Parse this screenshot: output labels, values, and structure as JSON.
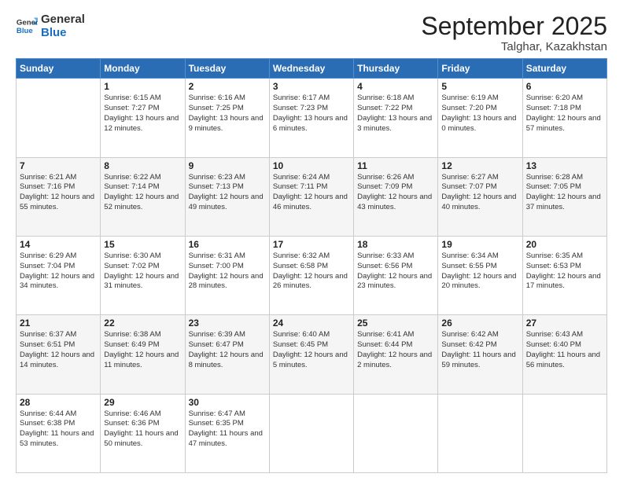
{
  "header": {
    "logo_general": "General",
    "logo_blue": "Blue",
    "month_title": "September 2025",
    "subtitle": "Talghar, Kazakhstan"
  },
  "days_of_week": [
    "Sunday",
    "Monday",
    "Tuesday",
    "Wednesday",
    "Thursday",
    "Friday",
    "Saturday"
  ],
  "weeks": [
    [
      {
        "day": "",
        "sunrise": "",
        "sunset": "",
        "daylight": ""
      },
      {
        "day": "1",
        "sunrise": "Sunrise: 6:15 AM",
        "sunset": "Sunset: 7:27 PM",
        "daylight": "Daylight: 13 hours and 12 minutes."
      },
      {
        "day": "2",
        "sunrise": "Sunrise: 6:16 AM",
        "sunset": "Sunset: 7:25 PM",
        "daylight": "Daylight: 13 hours and 9 minutes."
      },
      {
        "day": "3",
        "sunrise": "Sunrise: 6:17 AM",
        "sunset": "Sunset: 7:23 PM",
        "daylight": "Daylight: 13 hours and 6 minutes."
      },
      {
        "day": "4",
        "sunrise": "Sunrise: 6:18 AM",
        "sunset": "Sunset: 7:22 PM",
        "daylight": "Daylight: 13 hours and 3 minutes."
      },
      {
        "day": "5",
        "sunrise": "Sunrise: 6:19 AM",
        "sunset": "Sunset: 7:20 PM",
        "daylight": "Daylight: 13 hours and 0 minutes."
      },
      {
        "day": "6",
        "sunrise": "Sunrise: 6:20 AM",
        "sunset": "Sunset: 7:18 PM",
        "daylight": "Daylight: 12 hours and 57 minutes."
      }
    ],
    [
      {
        "day": "7",
        "sunrise": "Sunrise: 6:21 AM",
        "sunset": "Sunset: 7:16 PM",
        "daylight": "Daylight: 12 hours and 55 minutes."
      },
      {
        "day": "8",
        "sunrise": "Sunrise: 6:22 AM",
        "sunset": "Sunset: 7:14 PM",
        "daylight": "Daylight: 12 hours and 52 minutes."
      },
      {
        "day": "9",
        "sunrise": "Sunrise: 6:23 AM",
        "sunset": "Sunset: 7:13 PM",
        "daylight": "Daylight: 12 hours and 49 minutes."
      },
      {
        "day": "10",
        "sunrise": "Sunrise: 6:24 AM",
        "sunset": "Sunset: 7:11 PM",
        "daylight": "Daylight: 12 hours and 46 minutes."
      },
      {
        "day": "11",
        "sunrise": "Sunrise: 6:26 AM",
        "sunset": "Sunset: 7:09 PM",
        "daylight": "Daylight: 12 hours and 43 minutes."
      },
      {
        "day": "12",
        "sunrise": "Sunrise: 6:27 AM",
        "sunset": "Sunset: 7:07 PM",
        "daylight": "Daylight: 12 hours and 40 minutes."
      },
      {
        "day": "13",
        "sunrise": "Sunrise: 6:28 AM",
        "sunset": "Sunset: 7:05 PM",
        "daylight": "Daylight: 12 hours and 37 minutes."
      }
    ],
    [
      {
        "day": "14",
        "sunrise": "Sunrise: 6:29 AM",
        "sunset": "Sunset: 7:04 PM",
        "daylight": "Daylight: 12 hours and 34 minutes."
      },
      {
        "day": "15",
        "sunrise": "Sunrise: 6:30 AM",
        "sunset": "Sunset: 7:02 PM",
        "daylight": "Daylight: 12 hours and 31 minutes."
      },
      {
        "day": "16",
        "sunrise": "Sunrise: 6:31 AM",
        "sunset": "Sunset: 7:00 PM",
        "daylight": "Daylight: 12 hours and 28 minutes."
      },
      {
        "day": "17",
        "sunrise": "Sunrise: 6:32 AM",
        "sunset": "Sunset: 6:58 PM",
        "daylight": "Daylight: 12 hours and 26 minutes."
      },
      {
        "day": "18",
        "sunrise": "Sunrise: 6:33 AM",
        "sunset": "Sunset: 6:56 PM",
        "daylight": "Daylight: 12 hours and 23 minutes."
      },
      {
        "day": "19",
        "sunrise": "Sunrise: 6:34 AM",
        "sunset": "Sunset: 6:55 PM",
        "daylight": "Daylight: 12 hours and 20 minutes."
      },
      {
        "day": "20",
        "sunrise": "Sunrise: 6:35 AM",
        "sunset": "Sunset: 6:53 PM",
        "daylight": "Daylight: 12 hours and 17 minutes."
      }
    ],
    [
      {
        "day": "21",
        "sunrise": "Sunrise: 6:37 AM",
        "sunset": "Sunset: 6:51 PM",
        "daylight": "Daylight: 12 hours and 14 minutes."
      },
      {
        "day": "22",
        "sunrise": "Sunrise: 6:38 AM",
        "sunset": "Sunset: 6:49 PM",
        "daylight": "Daylight: 12 hours and 11 minutes."
      },
      {
        "day": "23",
        "sunrise": "Sunrise: 6:39 AM",
        "sunset": "Sunset: 6:47 PM",
        "daylight": "Daylight: 12 hours and 8 minutes."
      },
      {
        "day": "24",
        "sunrise": "Sunrise: 6:40 AM",
        "sunset": "Sunset: 6:45 PM",
        "daylight": "Daylight: 12 hours and 5 minutes."
      },
      {
        "day": "25",
        "sunrise": "Sunrise: 6:41 AM",
        "sunset": "Sunset: 6:44 PM",
        "daylight": "Daylight: 12 hours and 2 minutes."
      },
      {
        "day": "26",
        "sunrise": "Sunrise: 6:42 AM",
        "sunset": "Sunset: 6:42 PM",
        "daylight": "Daylight: 11 hours and 59 minutes."
      },
      {
        "day": "27",
        "sunrise": "Sunrise: 6:43 AM",
        "sunset": "Sunset: 6:40 PM",
        "daylight": "Daylight: 11 hours and 56 minutes."
      }
    ],
    [
      {
        "day": "28",
        "sunrise": "Sunrise: 6:44 AM",
        "sunset": "Sunset: 6:38 PM",
        "daylight": "Daylight: 11 hours and 53 minutes."
      },
      {
        "day": "29",
        "sunrise": "Sunrise: 6:46 AM",
        "sunset": "Sunset: 6:36 PM",
        "daylight": "Daylight: 11 hours and 50 minutes."
      },
      {
        "day": "30",
        "sunrise": "Sunrise: 6:47 AM",
        "sunset": "Sunset: 6:35 PM",
        "daylight": "Daylight: 11 hours and 47 minutes."
      },
      {
        "day": "",
        "sunrise": "",
        "sunset": "",
        "daylight": ""
      },
      {
        "day": "",
        "sunrise": "",
        "sunset": "",
        "daylight": ""
      },
      {
        "day": "",
        "sunrise": "",
        "sunset": "",
        "daylight": ""
      },
      {
        "day": "",
        "sunrise": "",
        "sunset": "",
        "daylight": ""
      }
    ]
  ]
}
